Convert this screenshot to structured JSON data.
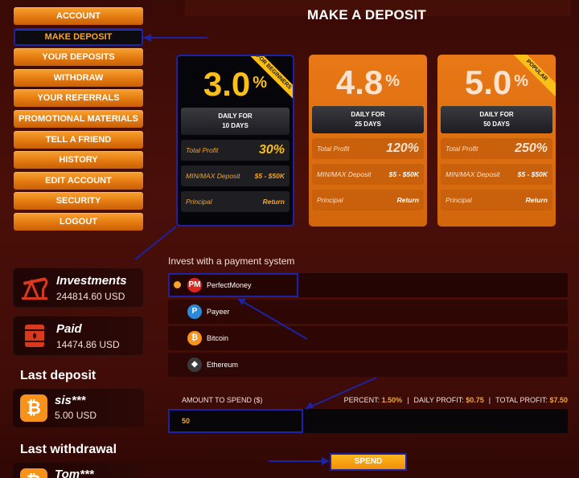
{
  "menu": [
    {
      "label": "ACCOUNT"
    },
    {
      "label": "MAKE DEPOSIT",
      "active": true
    },
    {
      "label": "YOUR DEPOSITS"
    },
    {
      "label": "WITHDRAW"
    },
    {
      "label": "YOUR REFERRALS"
    },
    {
      "label": "PROMOTIONAL MATERIALS"
    },
    {
      "label": "TELL A FRIEND"
    },
    {
      "label": "HISTORY"
    },
    {
      "label": "EDIT ACCOUNT"
    },
    {
      "label": "SECURITY"
    },
    {
      "label": "LOGOUT"
    }
  ],
  "stats": {
    "investments": {
      "title": "Investments",
      "value": "244814.60 USD",
      "icon": "oil-pump-icon"
    },
    "paid": {
      "title": "Paid",
      "value": "14474.86 USD",
      "icon": "oil-barrel-icon"
    }
  },
  "last_deposit": {
    "title": "Last deposit",
    "user": "sis***",
    "amount": "5.00 USD",
    "icon": "bitcoin-icon"
  },
  "last_withdrawal": {
    "title": "Last withdrawal",
    "user": "Tom***"
  },
  "page_title": "MAKE A DEPOSIT",
  "plans": [
    {
      "rate": "3.0",
      "pct": "%",
      "ribbon": "FOR BEGINNERS",
      "period_line1": "DAILY FOR",
      "period_line2": "10 DAYS",
      "total_label": "Total Profit",
      "total": "30%",
      "minmax_label": "MIN/MAX Deposit",
      "minmax": "$5 - $50K",
      "principal_label": "Principal",
      "principal": "Return"
    },
    {
      "rate": "4.8",
      "pct": "%",
      "ribbon": "",
      "period_line1": "DAILY FOR",
      "period_line2": "25 DAYS",
      "total_label": "Total Profit",
      "total": "120%",
      "minmax_label": "MIN/MAX Deposit",
      "minmax": "$5 - $50K",
      "principal_label": "Principal",
      "principal": "Return"
    },
    {
      "rate": "5.0",
      "pct": "%",
      "ribbon": "POPULAR",
      "period_line1": "DAILY FOR",
      "period_line2": "50 DAYS",
      "total_label": "Total Profit",
      "total": "250%",
      "minmax_label": "MIN/MAX Deposit",
      "minmax": "$5 - $50K",
      "principal_label": "Principal",
      "principal": "Return"
    }
  ],
  "payment": {
    "title": "Invest with a payment system",
    "systems": [
      {
        "name": "PerfectMoney",
        "icon": "perfectmoney-icon",
        "glyph": "PM",
        "color": "#d8261e",
        "selected": true
      },
      {
        "name": "Payeer",
        "icon": "payeer-icon",
        "glyph": "P",
        "color": "#2a8ad8"
      },
      {
        "name": "Bitcoin",
        "icon": "bitcoin-icon",
        "glyph": "₿",
        "color": "#f7931a"
      },
      {
        "name": "Ethereum",
        "icon": "ethereum-icon",
        "glyph": "◆",
        "color": "#3a3a3a"
      }
    ]
  },
  "amount": {
    "label": "AMOUNT TO SPEND ($)",
    "value": "50",
    "percent_label": "PERCENT:",
    "percent": "1.50%",
    "daily_label": "DAILY PROFIT:",
    "daily": "$0.75",
    "total_label": "TOTAL PROFIT:",
    "total": "$7.50"
  },
  "spend_label": "SPEND",
  "colors": {
    "accent": "#f5a52b",
    "highlight_border": "#1c23a6",
    "plan_orange": "#e97816"
  }
}
